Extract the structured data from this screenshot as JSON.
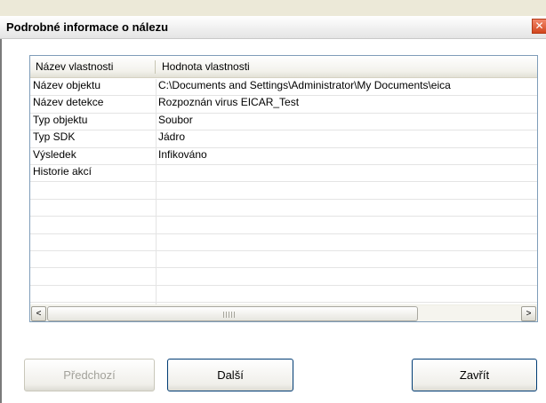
{
  "window": {
    "title": "Podrobné informace o nálezu",
    "close_glyph": "✕"
  },
  "listview": {
    "columns": [
      "Název vlastnosti",
      "Hodnota vlastnosti"
    ],
    "rows": [
      {
        "key": "Název objektu",
        "value": "C:\\Documents and Settings\\Administrator\\My Documents\\eica"
      },
      {
        "key": "Název detekce",
        "value": "Rozpoznán virus EICAR_Test"
      },
      {
        "key": "Typ objektu",
        "value": "Soubor"
      },
      {
        "key": "Typ SDK",
        "value": "Jádro"
      },
      {
        "key": "Výsledek",
        "value": "Infikováno"
      },
      {
        "key": "Historie akcí",
        "value": ""
      },
      {
        "key": "",
        "value": ""
      },
      {
        "key": "",
        "value": ""
      },
      {
        "key": "",
        "value": ""
      },
      {
        "key": "",
        "value": ""
      },
      {
        "key": "",
        "value": ""
      },
      {
        "key": "",
        "value": ""
      },
      {
        "key": "",
        "value": ""
      }
    ],
    "scroll_left_glyph": "<",
    "scroll_right_glyph": ">"
  },
  "buttons": {
    "previous": "Předchozí",
    "next": "Další",
    "close": "Zavřít"
  }
}
